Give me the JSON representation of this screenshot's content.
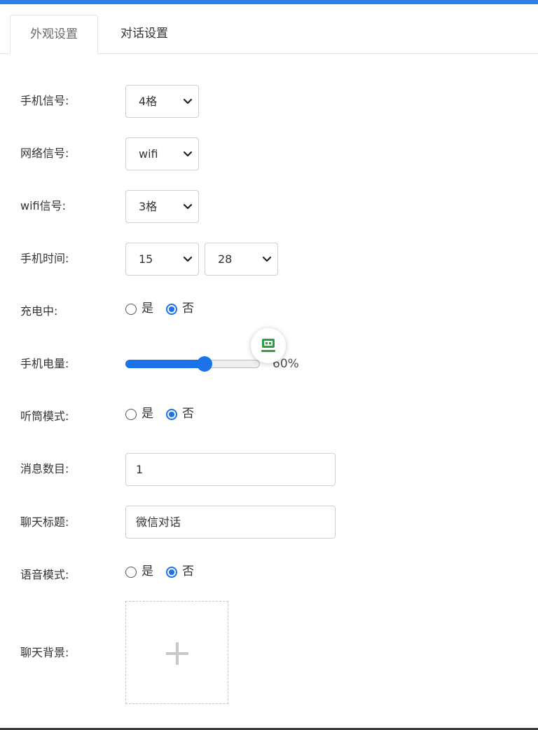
{
  "tabs": [
    {
      "label": "外观设置",
      "active": true
    },
    {
      "label": "对话设置",
      "active": false
    }
  ],
  "signal": {
    "label": "手机信号:",
    "value": "4格"
  },
  "network": {
    "label": "网络信号:",
    "value": "wifi"
  },
  "wifi": {
    "label": "wifi信号:",
    "value": "3格"
  },
  "time": {
    "label": "手机时间:",
    "hour": "15",
    "minute": "28"
  },
  "charging": {
    "label": "充电中:",
    "options": [
      "是",
      "否"
    ],
    "selected": "否"
  },
  "battery": {
    "label": "手机电量:",
    "level_percent": 60,
    "readout": "60%"
  },
  "earpiece": {
    "label": "听筒模式:",
    "options": [
      "是",
      "否"
    ],
    "selected": "否"
  },
  "messages": {
    "label": "消息数目:",
    "value": "1"
  },
  "chat_title": {
    "label": "聊天标题:",
    "value": "微信对话"
  },
  "voice": {
    "label": "语音模式:",
    "options": [
      "是",
      "否"
    ],
    "selected": "否"
  },
  "background": {
    "label": "聊天背景:"
  },
  "colors": {
    "accent": "#1a73e8",
    "top_bar": "#2f7fe8",
    "badge_icon": "#2e9f45"
  },
  "icons": {
    "select_arrow": "chevron-down-icon",
    "upload": "plus-icon",
    "badge": "robot-icon"
  }
}
